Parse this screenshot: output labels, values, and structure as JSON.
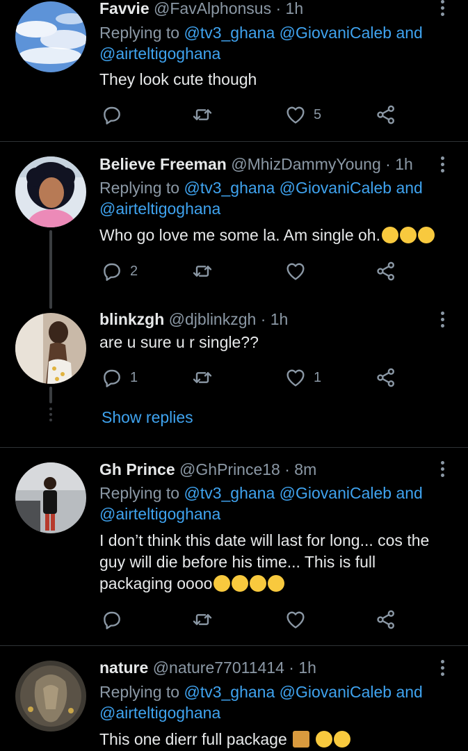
{
  "tweets": [
    {
      "name": "Favvie",
      "handle": "@FavAlphonsus",
      "time": "· 1h",
      "replying_prefix": "Replying to",
      "mentions": [
        "@tv3_ghana",
        "@GiovaniCaleb",
        "and",
        "@airteltigoghana"
      ],
      "text": "They look cute though",
      "replies": "",
      "retweets": "",
      "likes": "5"
    },
    {
      "name": "Believe Freeman",
      "handle": "@MhizDammyYoung",
      "time": "· 1h",
      "replying_prefix": "Replying to",
      "mentions": [
        "@tv3_ghana",
        "@GiovaniCaleb",
        "and",
        "@airteltigoghana"
      ],
      "text": "Who go love me some la. Am single  oh.",
      "replies": "2",
      "retweets": "",
      "likes": ""
    },
    {
      "name": "blinkzgh",
      "handle": "@djblinkzgh",
      "time": "· 1h",
      "text": "are u sure u r single??",
      "replies": "1",
      "retweets": "",
      "likes": "1"
    },
    {
      "name": "Gh Prince",
      "handle": "@GhPrince18",
      "time": "· 8m",
      "replying_prefix": "Replying to",
      "mentions": [
        "@tv3_ghana",
        "@GiovaniCaleb",
        "and",
        "@airteltigoghana"
      ],
      "text_lines": [
        "I don’t think this date will last for long... cos the",
        "guy will die before his time... This is full",
        "packaging oooo"
      ],
      "replies": "",
      "retweets": "",
      "likes": ""
    },
    {
      "name": "nature",
      "handle": "@nature77011414",
      "time": "· 1h",
      "replying_prefix": "Replying to",
      "mentions": [
        "@tv3_ghana",
        "@GiovaniCaleb",
        "and",
        "@airteltigoghana"
      ],
      "text": "This one dierr full package "
    }
  ],
  "show_replies_label": "Show replies",
  "colors": {
    "background": "#000000",
    "text": "#e7e9ea",
    "muted": "#8b98a5",
    "link": "#3fa3ef",
    "divider": "#2f3336"
  },
  "icons": [
    "reply-icon",
    "retweet-icon",
    "like-icon",
    "share-icon",
    "more-icon"
  ]
}
